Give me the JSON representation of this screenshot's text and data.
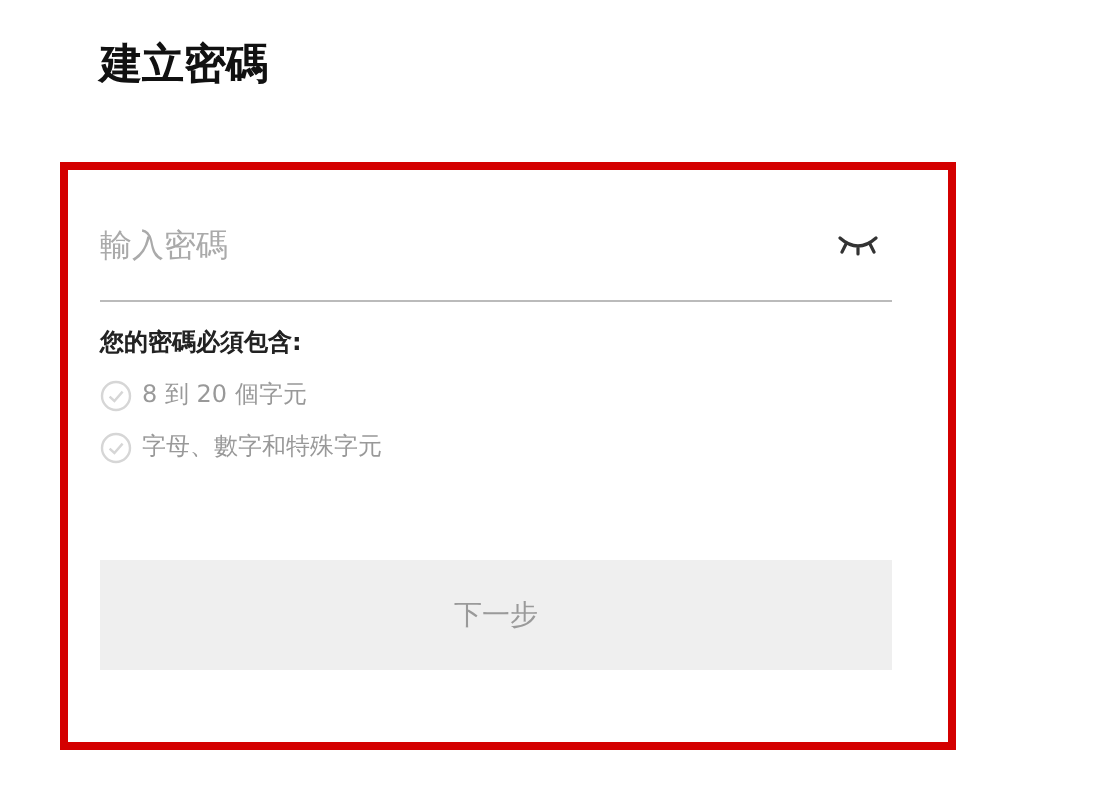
{
  "title": "建立密碼",
  "password_field": {
    "placeholder": "輸入密碼",
    "revealed": false
  },
  "requirements": {
    "heading": "您的密碼必須包含:",
    "items": [
      {
        "label": "8 到 20 個字元",
        "met": false
      },
      {
        "label": "字母、數字和特殊字元",
        "met": false
      }
    ]
  },
  "next_button": {
    "label": "下一步",
    "disabled": true
  }
}
